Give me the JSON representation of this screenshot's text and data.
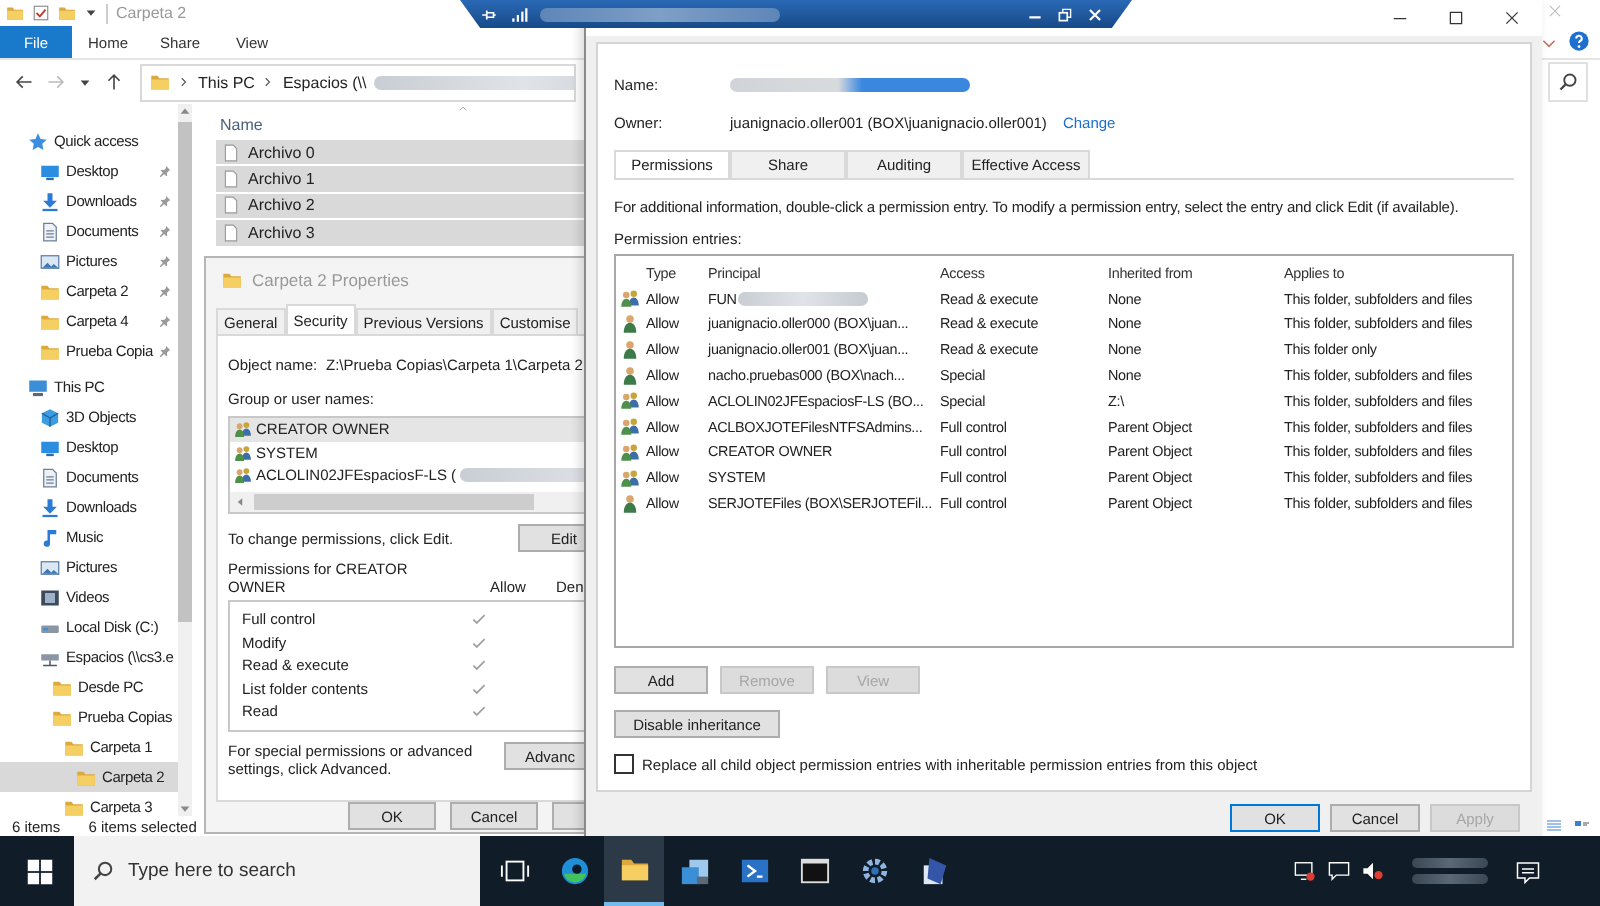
{
  "explorer": {
    "title": "Carpeta 2",
    "ribbon_tabs": [
      {
        "label": "File",
        "kind": "file"
      },
      {
        "label": "Home",
        "kind": "tab"
      },
      {
        "label": "Share",
        "kind": "tab"
      },
      {
        "label": "View",
        "kind": "tab"
      }
    ],
    "breadcrumb": [
      {
        "label": "This PC",
        "redacted": false
      },
      {
        "label": "Espacios (\\\\",
        "redacted": true
      }
    ],
    "nav": [
      {
        "label": "Quick access",
        "kind": "star",
        "selected": false,
        "children": [
          {
            "label": "Desktop",
            "kind": "desktop",
            "pinned": true,
            "selected": false
          },
          {
            "label": "Downloads",
            "kind": "download",
            "pinned": true,
            "selected": false
          },
          {
            "label": "Documents",
            "kind": "documents",
            "pinned": true,
            "selected": false
          },
          {
            "label": "Pictures",
            "kind": "pictures",
            "pinned": true,
            "selected": false
          },
          {
            "label": "Carpeta 2",
            "kind": "folder",
            "pinned": true,
            "selected": false
          },
          {
            "label": "Carpeta 4",
            "kind": "folder",
            "pinned": true,
            "selected": false
          },
          {
            "label": "Prueba Copia",
            "kind": "folder",
            "pinned": true,
            "selected": false
          }
        ]
      },
      {
        "label": "This PC",
        "kind": "pc",
        "selected": false,
        "children": [
          {
            "label": "3D Objects",
            "kind": "cube",
            "selected": false
          },
          {
            "label": "Desktop",
            "kind": "desktop",
            "selected": false
          },
          {
            "label": "Documents",
            "kind": "documents",
            "selected": false
          },
          {
            "label": "Downloads",
            "kind": "download",
            "selected": false
          },
          {
            "label": "Music",
            "kind": "music",
            "selected": false
          },
          {
            "label": "Pictures",
            "kind": "pictures",
            "selected": false
          },
          {
            "label": "Videos",
            "kind": "videos",
            "selected": false
          },
          {
            "label": "Local Disk (C:)",
            "kind": "disk",
            "selected": false
          },
          {
            "label": "Espacios (\\\\cs3.e",
            "kind": "network",
            "selected": false,
            "children": [
              {
                "label": "Desde PC",
                "kind": "folder",
                "selected": false
              },
              {
                "label": "Prueba Copias",
                "kind": "folder",
                "selected": false,
                "children": [
                  {
                    "label": "Carpeta 1",
                    "kind": "folder",
                    "selected": false,
                    "children": [
                      {
                        "label": "Carpeta 2",
                        "kind": "folder",
                        "selected": true
                      }
                    ]
                  },
                  {
                    "label": "Carpeta 3",
                    "kind": "folder",
                    "selected": false
                  }
                ]
              }
            ]
          }
        ]
      }
    ],
    "column": "Name",
    "files": [
      {
        "name": "Archivo 0",
        "selected": true
      },
      {
        "name": "Archivo 1",
        "selected": true
      },
      {
        "name": "Archivo 2",
        "selected": true
      },
      {
        "name": "Archivo 3",
        "selected": true
      }
    ],
    "status": [
      "6 items",
      "6 items selected"
    ]
  },
  "properties": {
    "title": "Carpeta 2 Properties",
    "tabs": [
      {
        "label": "General",
        "selected": false
      },
      {
        "label": "Security",
        "selected": true
      },
      {
        "label": "Previous Versions",
        "selected": false
      },
      {
        "label": "Customise",
        "selected": false
      }
    ],
    "object_name_label": "Object name:",
    "object_name": "Z:\\Prueba Copias\\Carpeta 1\\Carpeta 2",
    "group_label": "Group or user names:",
    "principals": [
      {
        "name": "CREATOR OWNER",
        "selected": true,
        "redacted": false
      },
      {
        "name": "SYSTEM",
        "selected": false,
        "redacted": false
      },
      {
        "name": "ACLOLIN02JFEspaciosF-LS (",
        "selected": false,
        "redacted": true
      }
    ],
    "edit_hint": "To change permissions, click Edit.",
    "edit_button": "Edit",
    "permissions_label": "Permissions for CREATOR OWNER",
    "allow_header": "Allow",
    "deny_header": "Den",
    "permissions": [
      {
        "name": "Full control",
        "allow": true
      },
      {
        "name": "Modify",
        "allow": true
      },
      {
        "name": "Read & execute",
        "allow": true
      },
      {
        "name": "List folder contents",
        "allow": true
      },
      {
        "name": "Read",
        "allow": true
      }
    ],
    "advanced_hint": "For special permissions or advanced settings, click Advanced.",
    "advanced_button": "Advanc",
    "buttons": [
      "OK",
      "Cancel"
    ]
  },
  "security": {
    "name_label": "Name:",
    "name_redacted": true,
    "owner_label": "Owner:",
    "owner": "juanignacio.oller001 (BOX\\juanignacio.oller001)",
    "change_link": "Change",
    "tabs": [
      {
        "label": "Permissions",
        "selected": true
      },
      {
        "label": "Share",
        "selected": false
      },
      {
        "label": "Auditing",
        "selected": false
      },
      {
        "label": "Effective Access",
        "selected": false
      }
    ],
    "info": "For additional information, double-click a permission entry. To modify a permission entry, select the entry and click Edit (if available).",
    "entries_label": "Permission entries:",
    "columns": [
      "Type",
      "Principal",
      "Access",
      "Inherited from",
      "Applies to"
    ],
    "entries": [
      {
        "kind": "group",
        "type": "Allow",
        "principal": "FUN",
        "redacted": true,
        "access": "Read & execute",
        "inherited_from": "None",
        "applies_to": "This folder, subfolders and files"
      },
      {
        "kind": "user",
        "type": "Allow",
        "principal": "juanignacio.oller000 (BOX\\juan...",
        "redacted": false,
        "access": "Read & execute",
        "inherited_from": "None",
        "applies_to": "This folder, subfolders and files"
      },
      {
        "kind": "user",
        "type": "Allow",
        "principal": "juanignacio.oller001 (BOX\\juan...",
        "redacted": false,
        "access": "Read & execute",
        "inherited_from": "None",
        "applies_to": "This folder only"
      },
      {
        "kind": "user",
        "type": "Allow",
        "principal": "nacho.pruebas000 (BOX\\nach...",
        "redacted": false,
        "access": "Special",
        "inherited_from": "None",
        "applies_to": "This folder, subfolders and files"
      },
      {
        "kind": "group",
        "type": "Allow",
        "principal": "ACLOLIN02JFEspaciosF-LS (BO...",
        "redacted": false,
        "access": "Special",
        "inherited_from": "Z:\\",
        "applies_to": "This folder, subfolders and files"
      },
      {
        "kind": "group",
        "type": "Allow",
        "principal": "ACLBOXJOTEFilesNTFSAdmins...",
        "redacted": false,
        "access": "Full control",
        "inherited_from": "Parent Object",
        "applies_to": "This folder, subfolders and files"
      },
      {
        "kind": "group",
        "type": "Allow",
        "principal": "CREATOR OWNER",
        "redacted": false,
        "access": "Full control",
        "inherited_from": "Parent Object",
        "applies_to": "This folder, subfolders and files"
      },
      {
        "kind": "group",
        "type": "Allow",
        "principal": "SYSTEM",
        "redacted": false,
        "access": "Full control",
        "inherited_from": "Parent Object",
        "applies_to": "This folder, subfolders and files"
      },
      {
        "kind": "user",
        "type": "Allow",
        "principal": "SERJOTEFiles (BOX\\SERJOTEFil...",
        "redacted": false,
        "access": "Full control",
        "inherited_from": "Parent Object",
        "applies_to": "This folder, subfolders and files"
      }
    ],
    "buttons": [
      {
        "label": "Add",
        "disabled": false
      },
      {
        "label": "Remove",
        "disabled": true
      },
      {
        "label": "View",
        "disabled": true
      }
    ],
    "inheritance_button": "Disable inheritance",
    "replace_option": {
      "label": "Replace all child object permission entries with inheritable permission entries from this object",
      "checked": false
    },
    "dialog_buttons": [
      {
        "label": "OK",
        "default": true,
        "disabled": false
      },
      {
        "label": "Cancel",
        "default": false,
        "disabled": false
      },
      {
        "label": "Apply",
        "default": false,
        "disabled": true
      }
    ]
  },
  "taskbar": {
    "search": {
      "placeholder": "Type here to search"
    },
    "apps": [
      {
        "kind": "task-view",
        "active": false
      },
      {
        "kind": "edge",
        "active": false
      },
      {
        "kind": "explorer",
        "active": true
      },
      {
        "kind": "server",
        "active": false
      },
      {
        "kind": "powershell",
        "active": false
      },
      {
        "kind": "terminal",
        "active": false
      },
      {
        "kind": "settings",
        "active": false
      },
      {
        "kind": "setup",
        "active": false
      }
    ]
  }
}
